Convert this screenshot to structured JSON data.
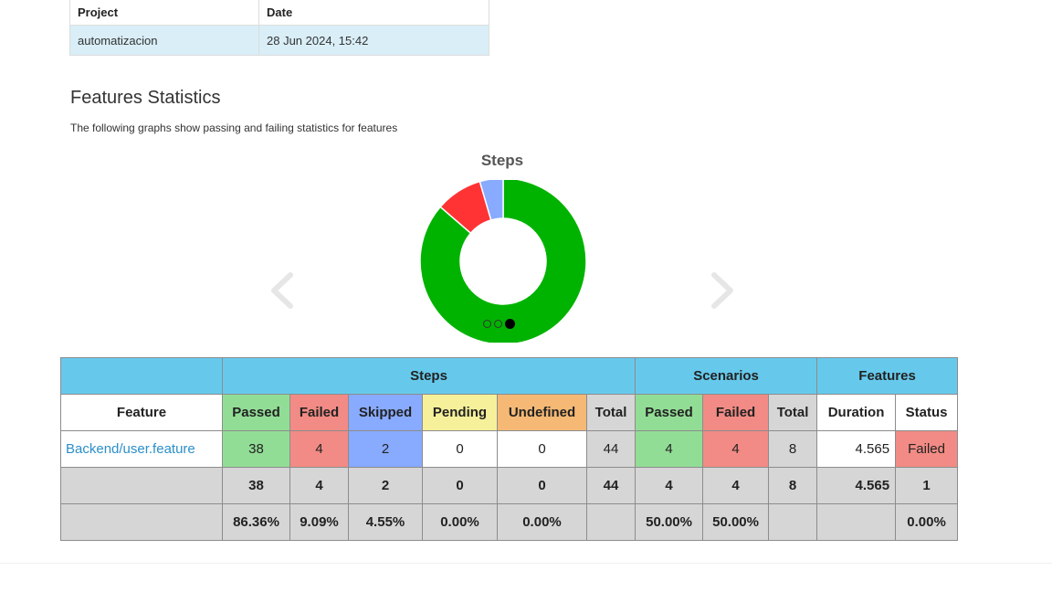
{
  "info": {
    "headers": [
      "Project",
      "Date"
    ],
    "row": [
      "automatizacion",
      "28 Jun 2024, 15:42"
    ]
  },
  "section": {
    "title": "Features Statistics",
    "description": "The following graphs show passing and failing statistics for features"
  },
  "chart_data": {
    "type": "pie",
    "title": "Steps",
    "variant": "donut",
    "categories": [
      "Passed",
      "Failed",
      "Skipped"
    ],
    "values": [
      38,
      4,
      2
    ],
    "colors": [
      "#00b300",
      "#ff3333",
      "#88aaff"
    ]
  },
  "carousel": {
    "prev_icon": "chevron-left-icon",
    "next_icon": "chevron-right-icon",
    "indicator_count": 3,
    "active_indicator": 2
  },
  "stats": {
    "groups": {
      "steps": "Steps",
      "scenarios": "Scenarios",
      "features": "Features"
    },
    "columns": {
      "feature": "Feature",
      "steps_passed": "Passed",
      "steps_failed": "Failed",
      "steps_skipped": "Skipped",
      "steps_pending": "Pending",
      "steps_undefined": "Undefined",
      "steps_total": "Total",
      "scen_passed": "Passed",
      "scen_failed": "Failed",
      "scen_total": "Total",
      "duration": "Duration",
      "status": "Status"
    },
    "row": {
      "feature": "Backend/user.feature",
      "steps_passed": "38",
      "steps_failed": "4",
      "steps_skipped": "2",
      "steps_pending": "0",
      "steps_undefined": "0",
      "steps_total": "44",
      "scen_passed": "4",
      "scen_failed": "4",
      "scen_total": "8",
      "duration": "4.565",
      "status": "Failed"
    },
    "totals": {
      "steps_passed": "38",
      "steps_failed": "4",
      "steps_skipped": "2",
      "steps_pending": "0",
      "steps_undefined": "0",
      "steps_total": "44",
      "scen_passed": "4",
      "scen_failed": "4",
      "scen_total": "8",
      "duration": "4.565",
      "status": "1"
    },
    "percentages": {
      "steps_passed": "86.36%",
      "steps_failed": "9.09%",
      "steps_skipped": "4.55%",
      "steps_pending": "0.00%",
      "steps_undefined": "0.00%",
      "scen_passed": "50.00%",
      "scen_failed": "50.00%",
      "status": "0.00%"
    }
  }
}
